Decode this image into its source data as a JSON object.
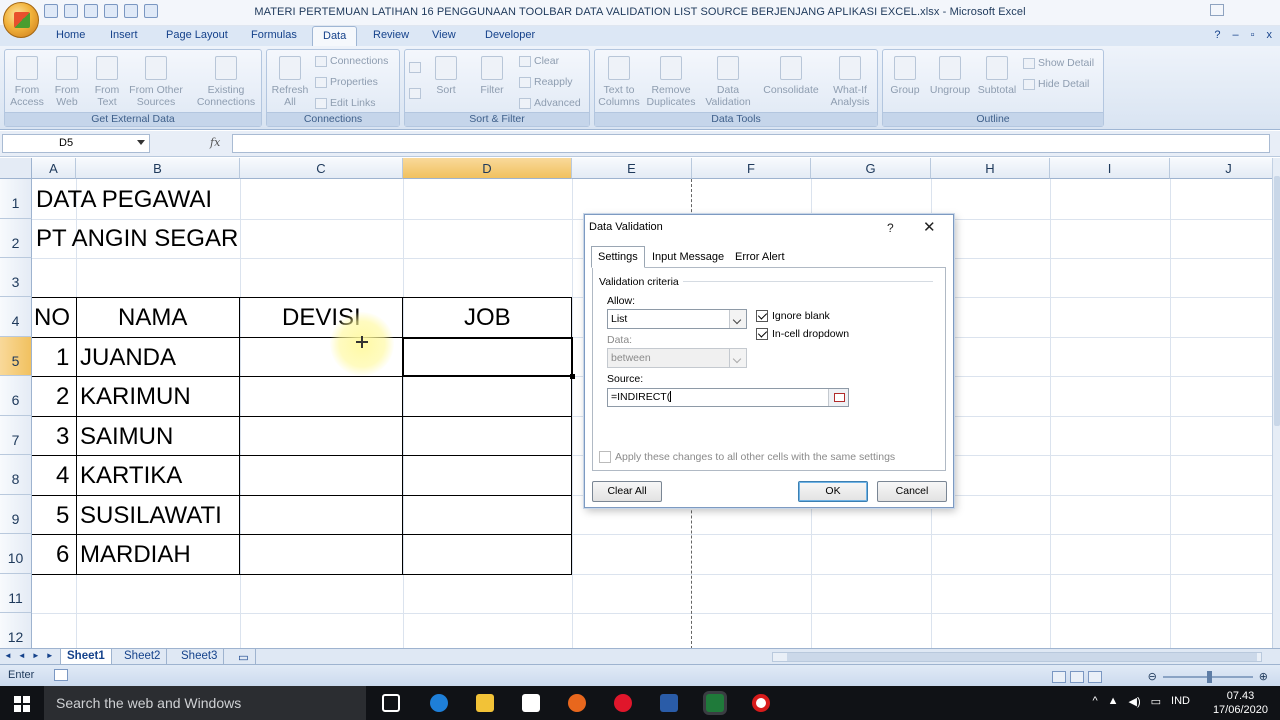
{
  "window": {
    "title": "MATERI PERTEMUAN LATIHAN 16 PENGGUNAAN TOOLBAR DATA VALIDATION LIST SOURCE BERJENJANG APLIKASI EXCEL.xlsx - Microsoft Excel"
  },
  "ribbon_tabs": [
    "Home",
    "Insert",
    "Page Layout",
    "Formulas",
    "Data",
    "Review",
    "View",
    "Developer"
  ],
  "ribbon_groups": {
    "get_external_data": {
      "label": "Get External Data",
      "buttons": [
        "From Access",
        "From Web",
        "From Text",
        "From Other Sources",
        "Existing Connections"
      ]
    },
    "connections": {
      "label": "Connections",
      "refresh": "Refresh All",
      "items": [
        "Connections",
        "Properties",
        "Edit Links"
      ]
    },
    "sort_filter": {
      "label": "Sort & Filter",
      "sort": "Sort",
      "filter": "Filter",
      "items": [
        "Clear",
        "Reapply",
        "Advanced"
      ]
    },
    "data_tools": {
      "label": "Data Tools",
      "buttons": [
        "Text to Columns",
        "Remove Duplicates",
        "Data Validation",
        "Consolidate",
        "What-If Analysis"
      ]
    },
    "outline": {
      "label": "Outline",
      "buttons": [
        "Group",
        "Ungroup",
        "Subtotal"
      ],
      "items": [
        "Show Detail",
        "Hide Detail"
      ]
    }
  },
  "formula_bar": {
    "name_box": "D5",
    "fx": "fx",
    "formula": ""
  },
  "columns": [
    "A",
    "B",
    "C",
    "D",
    "E",
    "F",
    "G",
    "H",
    "I",
    "J"
  ],
  "rows": [
    "1",
    "2",
    "3",
    "4",
    "5",
    "6",
    "7",
    "8",
    "9",
    "10",
    "11",
    "12"
  ],
  "sheet": {
    "title1": "DATA PEGAWAI",
    "title2": "PT ANGIN SEGAR",
    "headers": {
      "no": "NO",
      "nama": "NAMA",
      "devisi": "DEVISI",
      "job": "JOB"
    },
    "records": [
      {
        "no": "1",
        "nama": "JUANDA"
      },
      {
        "no": "2",
        "nama": "KARIMUN"
      },
      {
        "no": "3",
        "nama": "SAIMUN"
      },
      {
        "no": "4",
        "nama": "KARTIKA"
      },
      {
        "no": "5",
        "nama": "SUSILAWATI"
      },
      {
        "no": "6",
        "nama": "MARDIAH"
      }
    ]
  },
  "sheet_tabs": [
    "Sheet1",
    "Sheet2",
    "Sheet3"
  ],
  "status": {
    "mode": "Enter"
  },
  "dialog": {
    "title": "Data Validation",
    "help": "?",
    "close": "✕",
    "tabs": [
      "Settings",
      "Input Message",
      "Error Alert"
    ],
    "criteria_label": "Validation criteria",
    "allow_label": "Allow:",
    "allow_value": "List",
    "ignore_blank": "Ignore blank",
    "in_cell_dropdown": "In-cell dropdown",
    "data_label": "Data:",
    "data_value": "between",
    "source_label": "Source:",
    "source_value": "=INDIRECT(",
    "apply_all": "Apply these changes to all other cells with the same settings",
    "clear_all": "Clear All",
    "ok": "OK",
    "cancel": "Cancel"
  },
  "taskbar": {
    "search_placeholder": "Search the web and Windows",
    "language": "IND",
    "time": "07.43",
    "date": "17/06/2020"
  }
}
